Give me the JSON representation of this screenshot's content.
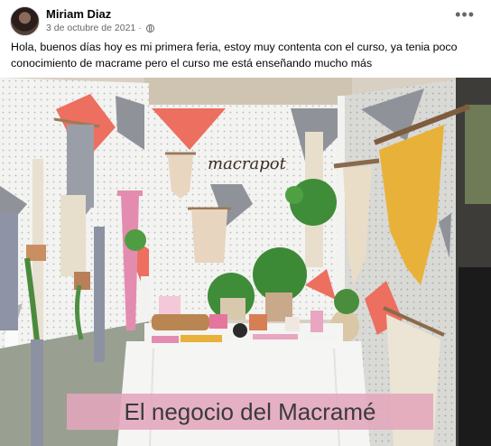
{
  "post": {
    "author": "Miriam Diaz",
    "date": "3 de octubre de 2021",
    "separator": "·",
    "privacy_icon": "globe-icon",
    "more_label": "•••",
    "text": "Hola, buenos días hoy  es mi primera feria, estoy muy contenta con el curso, ya tenia poco conocimiento de macrame pero el curso me está enseñando mucho más"
  },
  "photo": {
    "sign_text": "macrapot",
    "caption": "El negocio del Macramé"
  },
  "colors": {
    "coral": "#ec6f60",
    "gray_triangle": "#8f9399",
    "mustard": "#e8b23a",
    "pink": "#e1a6bc"
  }
}
